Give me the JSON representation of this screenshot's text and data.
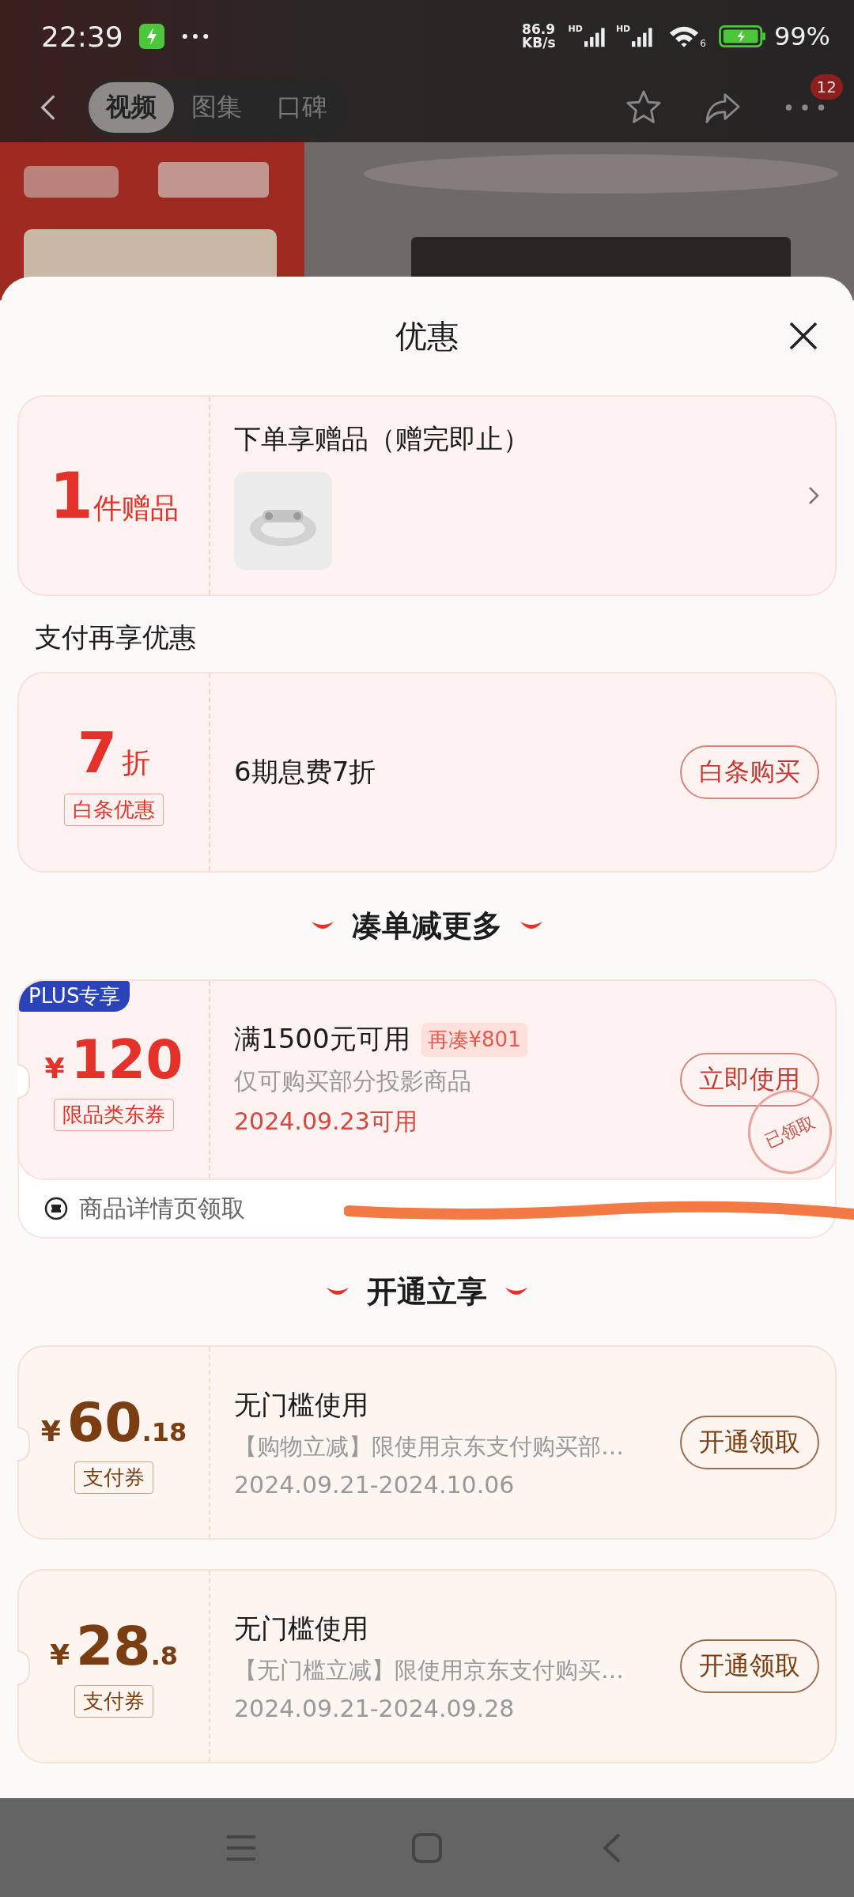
{
  "status_bar": {
    "time": "22:39",
    "speed_value": "86.9",
    "speed_unit": "KB/s",
    "signal_labels": [
      "HD",
      "HD"
    ],
    "wifi_label": "6",
    "battery": "99%"
  },
  "nav": {
    "tabs": [
      {
        "label": "视频",
        "selected": true
      },
      {
        "label": "图集",
        "selected": false
      },
      {
        "label": "口碑",
        "selected": false
      }
    ],
    "badge": "12"
  },
  "sheet": {
    "title": "优惠"
  },
  "gift_card": {
    "count": "1",
    "unit": "件赠品",
    "title": "下单享赠品（赠完即止）"
  },
  "payment_section": {
    "heading": "支付再享优惠",
    "card": {
      "amount": "7",
      "unit": "折",
      "tag": "白条优惠",
      "title": "6期息费7折",
      "button": "白条购买"
    }
  },
  "bundle_section": {
    "heading": "凑单减更多",
    "coupon": {
      "badge": "PLUS专享",
      "currency": "¥",
      "amount": "120",
      "tag": "限品类东券",
      "title": "满1500元可用",
      "extra": "再凑¥801",
      "desc": "仅可购买部分投影商品",
      "date": "2024.09.23可用",
      "button": "立即使用",
      "stamp": "已领取",
      "footer": "商品详情页领取"
    }
  },
  "member_section": {
    "heading": "开通立享",
    "coupons": [
      {
        "currency": "¥",
        "integer": "60",
        "decimal": ".18",
        "tag": "支付券",
        "title": "无门槛使用",
        "desc": "【购物立减】限使用京东支付购买部…",
        "date": "2024.09.21-2024.10.06",
        "button": "开通领取"
      },
      {
        "currency": "¥",
        "integer": "28",
        "decimal": ".8",
        "tag": "支付券",
        "title": "无门槛使用",
        "desc": "【无门槛立减】限使用京东支付购买…",
        "date": "2024.09.21-2024.09.28",
        "button": "开通领取"
      }
    ]
  }
}
